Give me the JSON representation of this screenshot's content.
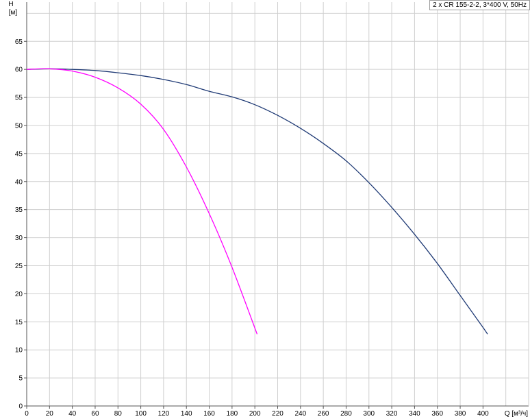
{
  "chart_data": {
    "type": "line",
    "title": "2 x CR 155-2-2, 3*400 V, 50Hz",
    "xlabel": "Q [м³/ч]",
    "ylabel_top": "H",
    "ylabel_unit": "[м]",
    "xlim": [
      0,
      440
    ],
    "ylim": [
      0,
      72
    ],
    "x_ticks": [
      "0",
      "20",
      "40",
      "60",
      "80",
      "100",
      "120",
      "140",
      "160",
      "180",
      "200",
      "220",
      "240",
      "260",
      "280",
      "300",
      "320",
      "340",
      "360",
      "380",
      "400"
    ],
    "y_ticks": [
      "0",
      "5",
      "10",
      "15",
      "20",
      "25",
      "30",
      "35",
      "40",
      "45",
      "50",
      "55",
      "60",
      "65"
    ],
    "grid": true,
    "series": [
      {
        "color": "#1f3a75",
        "x": [
          0,
          20,
          40,
          60,
          80,
          100,
          120,
          140,
          160,
          180,
          200,
          220,
          240,
          260,
          280,
          300,
          320,
          340,
          360,
          380,
          400,
          404
        ],
        "y": [
          60,
          60.1,
          60,
          59.8,
          59.4,
          58.9,
          58.2,
          57.3,
          56.1,
          55.1,
          53.7,
          51.8,
          49.5,
          46.8,
          43.7,
          39.8,
          35.4,
          30.6,
          25.4,
          19.7,
          14,
          12.8
        ]
      },
      {
        "color": "#ff00ff",
        "x": [
          0,
          20,
          40,
          60,
          80,
          100,
          120,
          140,
          160,
          180,
          202
        ],
        "y": [
          60,
          60.1,
          59.7,
          58.6,
          56.7,
          53.8,
          49.3,
          42.6,
          34.3,
          24.7,
          12.8
        ]
      }
    ]
  }
}
